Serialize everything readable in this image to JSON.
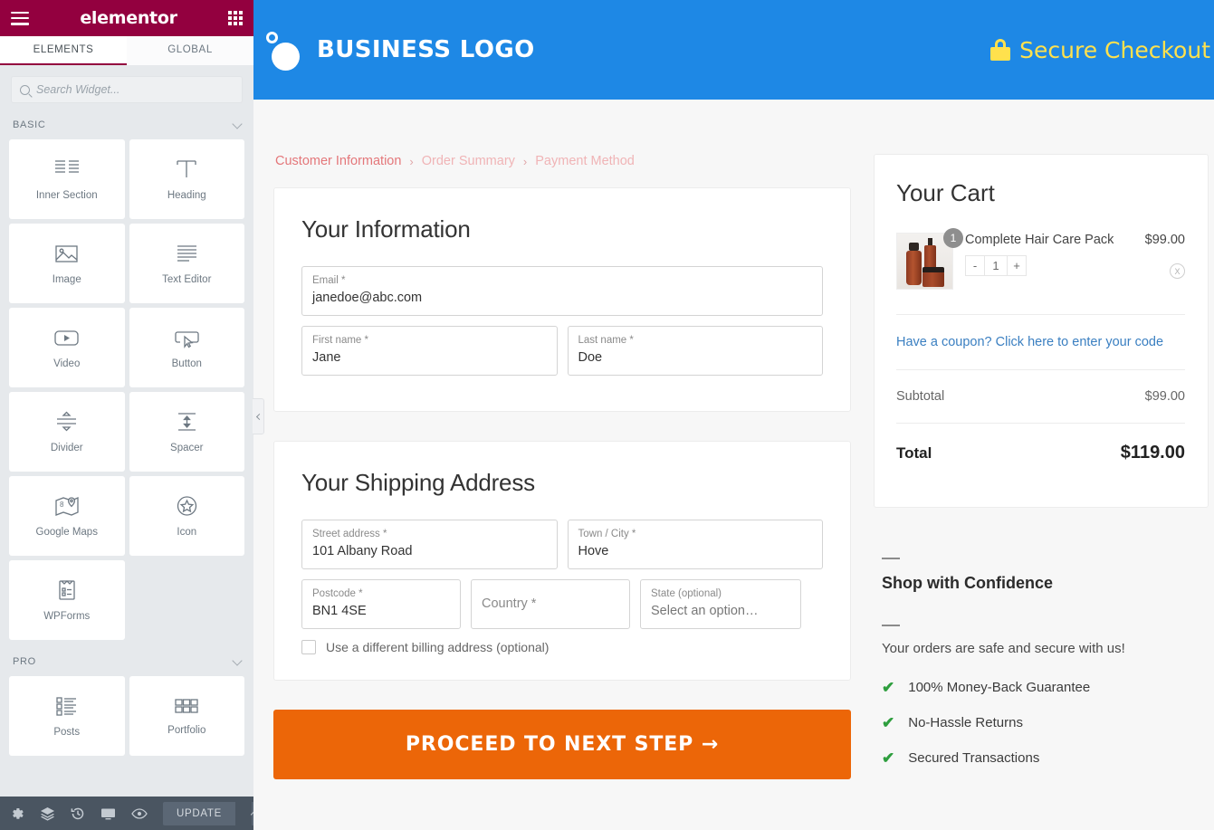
{
  "editor": {
    "brand": "elementor",
    "menu_icon": "hamburger-icon",
    "apps_icon": "grid-icon",
    "tabs": [
      {
        "label": "ELEMENTS",
        "active": true
      },
      {
        "label": "GLOBAL",
        "active": false
      }
    ],
    "search": {
      "placeholder": "Search Widget...",
      "value": ""
    },
    "categories": [
      {
        "label": "BASIC"
      },
      {
        "label": "PRO"
      }
    ],
    "widgets_basic": [
      {
        "label": "Inner Section",
        "icon": "inner-section-icon"
      },
      {
        "label": "Heading",
        "icon": "heading-icon"
      },
      {
        "label": "Image",
        "icon": "image-icon"
      },
      {
        "label": "Text Editor",
        "icon": "text-editor-icon"
      },
      {
        "label": "Video",
        "icon": "video-icon"
      },
      {
        "label": "Button",
        "icon": "button-icon"
      },
      {
        "label": "Divider",
        "icon": "divider-icon"
      },
      {
        "label": "Spacer",
        "icon": "spacer-icon"
      },
      {
        "label": "Google Maps",
        "icon": "google-maps-icon"
      },
      {
        "label": "Icon",
        "icon": "star-icon"
      },
      {
        "label": "WPForms",
        "icon": "wpforms-icon"
      }
    ],
    "widgets_pro": [
      {
        "label": "Posts",
        "icon": "posts-icon"
      },
      {
        "label": "Portfolio",
        "icon": "portfolio-icon"
      }
    ],
    "footer": {
      "settings_icon": "gear-icon",
      "navigator_icon": "layers-icon",
      "history_icon": "history-icon",
      "responsive_icon": "monitor-icon",
      "preview_icon": "eye-icon",
      "update_label": "UPDATE",
      "update_caret_icon": "caret-up-icon"
    },
    "collapse_handle_icon": "chevron-left-icon",
    "colors": {
      "brand_maroon": "#93003f",
      "panel_bg": "#e6e9ec",
      "footer_bg": "#4a5561"
    }
  },
  "preview": {
    "header": {
      "logo_text": "BUSINESS LOGO",
      "logo_icon": "circles-logo-icon",
      "secure_label": "Secure Checkout",
      "lock_icon": "lock-icon",
      "bg_color": "#1e88e5",
      "secure_color": "#ffe14d"
    },
    "breadcrumb": [
      {
        "label": "Customer Information",
        "active": true
      },
      {
        "label": "Order Summary",
        "active": false
      },
      {
        "label": "Payment Method",
        "active": false
      }
    ],
    "breadcrumb_separator": "›",
    "your_information": {
      "title": "Your Information",
      "email": {
        "label": "Email *",
        "value": "janedoe@abc.com"
      },
      "first_name": {
        "label": "First name *",
        "value": "Jane"
      },
      "last_name": {
        "label": "Last name *",
        "value": "Doe"
      }
    },
    "shipping": {
      "title": "Your Shipping Address",
      "street": {
        "label": "Street address *",
        "value": "101 Albany Road"
      },
      "city": {
        "label": "Town / City *",
        "value": "Hove"
      },
      "postcode": {
        "label": "Postcode *",
        "value": "BN1 4SE"
      },
      "country": {
        "label": "Country *",
        "value": ""
      },
      "state": {
        "label": "State (optional)",
        "value": "Select an option…"
      },
      "billing_checkbox": {
        "label": "Use a different billing address (optional)",
        "checked": false
      }
    },
    "proceed_button": {
      "label": "PROCEED TO NEXT STEP →",
      "color": "#ec6608"
    },
    "cart": {
      "title": "Your Cart",
      "item": {
        "name": "Complete Hair Care Pack",
        "price": "$99.00",
        "qty_badge": "1",
        "qty_value": "1",
        "minus_label": "-",
        "plus_label": "+",
        "remove_label": "X",
        "thumb_icon": "product-thumbnail"
      },
      "coupon_link": "Have a coupon? Click here to enter your code",
      "subtotal": {
        "label": "Subtotal",
        "value": "$99.00"
      },
      "total": {
        "label": "Total",
        "value": "$119.00"
      }
    },
    "confidence": {
      "title": "Shop with Confidence",
      "subtitle": "Your orders are safe and secure with us!",
      "items": [
        {
          "label": "100% Money-Back Guarantee"
        },
        {
          "label": "No-Hassle Returns"
        },
        {
          "label": "Secured Transactions"
        }
      ],
      "check_color": "#2e9e3e"
    }
  }
}
